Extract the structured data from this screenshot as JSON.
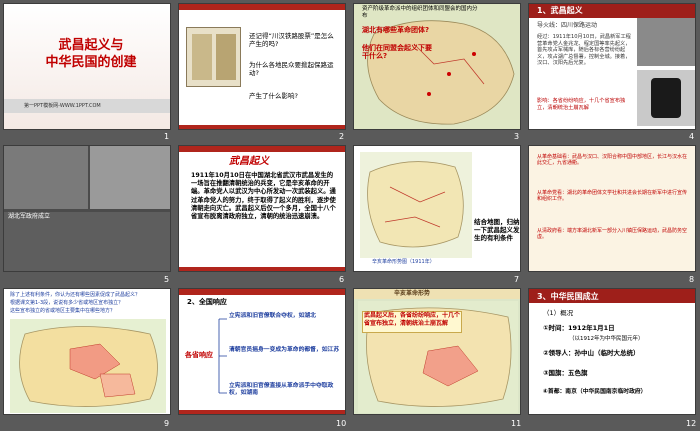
{
  "slides": [
    {
      "num": "1",
      "title": "武昌起义与\n中华民国的创建",
      "footer": "第一PPT模板网-WWW.1PPT.COM"
    },
    {
      "num": "2",
      "bullets": [
        "还记得“川汉铁路股票”是怎么产生的吗?",
        "为什么各地民众要掀起保路运动?",
        "产生了什么影响?"
      ]
    },
    {
      "num": "3",
      "map_title": "资产阶级革命派中的组织团体和同盟会的国内分布",
      "question": "湖北有哪些革命团体?\n\n他们在同盟会起义下要干什么?"
    },
    {
      "num": "4",
      "heading": "1、武昌起义",
      "subtitle": "导火线：四川保路运动",
      "body": "经过：1911年10月10日，武昌新军工程营革命党人金兆龙、程定国等率先起义，首先攻占军械库，随后各标各营纷纷起义，攻占湖广总督署，控制全城。接着，汉口、汉阳先后光复。",
      "impact": "影响：各省纷纷响应，十几个省宣布独立，清朝统治土崩瓦解"
    },
    {
      "num": "5",
      "caption": "湖北军政府成立"
    },
    {
      "num": "6",
      "heading": "武昌起义",
      "body": "1911年10月10日在中国湖北省武汉市武昌发生的一场旨在推翻清朝统治的兵变，它是辛亥革命的开端。革命党人以武汉为中心所发动一次武装起义。通过革命党人的努力，终于取得了起义的胜利，逐步使清朝走向灭亡。武昌起义后仅一个多月，全国十八个省宣布脱离清政府独立，清朝的统治迅速崩溃。"
    },
    {
      "num": "7",
      "note": "结合地图，归纳一下武昌起义发生的有利条件",
      "caption": "辛亥革命形势图（1911年）"
    },
    {
      "num": "8",
      "points": [
        "从革命基础看：武昌与汉口、汉阳合称中国中部地区，长江与汉水在此交汇，九省通衢。",
        "从革命党看：湖北的革命团体文学社和共进会长期在新军中进行宣传和组织工作。",
        "从清政府看：端方率湖北新军一部分入川镇压保路运动，武昌防务空虚。"
      ]
    },
    {
      "num": "9",
      "questions": [
        "除了上述有利条件，你认为还有哪些因素促成了武昌起义？",
        "根据课文第1-3段，说说有多少省或地区宣布独立？",
        "这些宣布独立的省或地区主要集中在哪些地方？"
      ]
    },
    {
      "num": "10",
      "heading": "2、全国响应",
      "label": "各省响应",
      "items": [
        "立宪派和旧官僚联合夺权，如湖北",
        "清朝官员摇身一变成为革命的都督，如江苏",
        "立宪派和旧官僚直接从革命派手中夺取政权，如湖南"
      ]
    },
    {
      "num": "11",
      "banner": "辛亥革命形势",
      "text": "武昌起义后，各省纷纷响应，十几个省宣布独立，清朝统治土崩瓦解"
    },
    {
      "num": "12",
      "heading": "3、中华民国成立",
      "overview": "（1）概况",
      "items": [
        "①时间：1912年1月1日",
        "（以1912年为中华民国元年）",
        "②领导人：孙中山（临时大总统）",
        "③国旗：五色旗",
        "④首都：南京（中华民国南京临时政府）"
      ]
    }
  ]
}
